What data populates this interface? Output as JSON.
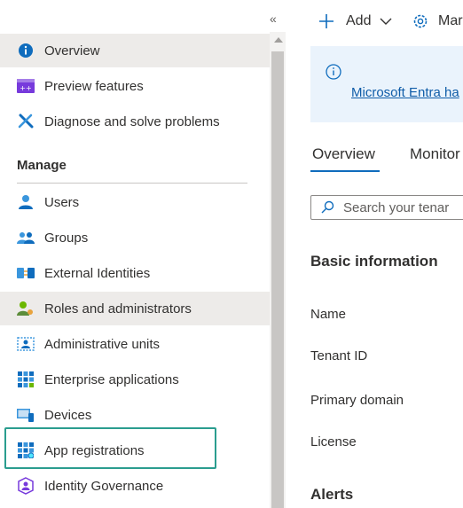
{
  "sidebar": {
    "collapse_glyph": "«",
    "top_items": [
      {
        "label": "Overview",
        "icon": "info-icon"
      },
      {
        "label": "Preview features",
        "icon": "preview-features-icon"
      },
      {
        "label": "Diagnose and solve problems",
        "icon": "wrench-icon"
      }
    ],
    "manage_heading": "Manage",
    "manage_items": [
      {
        "label": "Users",
        "icon": "user-icon"
      },
      {
        "label": "Groups",
        "icon": "groups-icon"
      },
      {
        "label": "External Identities",
        "icon": "external-identities-icon"
      },
      {
        "label": "Roles and administrators",
        "icon": "roles-icon"
      },
      {
        "label": "Administrative units",
        "icon": "admin-units-icon"
      },
      {
        "label": "Enterprise applications",
        "icon": "enterprise-apps-icon"
      },
      {
        "label": "Devices",
        "icon": "devices-icon"
      },
      {
        "label": "App registrations",
        "icon": "app-registrations-icon"
      },
      {
        "label": "Identity Governance",
        "icon": "identity-governance-icon"
      }
    ]
  },
  "toolbar": {
    "add_label": "Add",
    "manage_label": "Mar"
  },
  "banner": {
    "link_text": "Microsoft Entra ha"
  },
  "tabs": [
    {
      "label": "Overview",
      "selected": true
    },
    {
      "label": "Monitor",
      "selected": false
    }
  ],
  "search": {
    "placeholder": "Search your tenar"
  },
  "basic_info": {
    "heading": "Basic information",
    "fields": [
      "Name",
      "Tenant ID",
      "Primary domain",
      "License"
    ]
  },
  "alerts": {
    "heading": "Alerts"
  },
  "colors": {
    "accent": "#0f6cbd",
    "highlight_border": "#2a9d8f",
    "banner_bg": "#eaf3fc",
    "selected_bg": "#edebe9"
  }
}
